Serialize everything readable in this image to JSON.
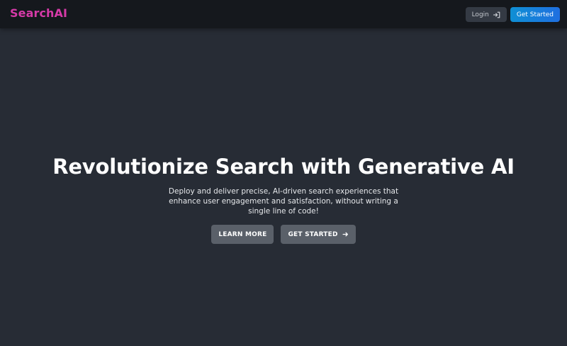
{
  "navbar": {
    "brand": "SearchAI",
    "login_label": "Login",
    "login_icon": "sign-in-icon",
    "get_started_label": "Get Started"
  },
  "hero": {
    "title": "Revolutionize Search with Generative AI",
    "subtitle": "Deploy and deliver precise, AI-driven search experiences that enhance user engagement and satisfaction, without writing a single line of code!",
    "learn_more_label": "LEARN MORE",
    "get_started_label": "GET STARTED",
    "get_started_icon": "arrow-right-icon"
  },
  "colors": {
    "background": "#272c35",
    "navbar": "#15181d",
    "brand": "#d63aa8",
    "primary_button": "#1f6fe0",
    "secondary_button": "#5a6069"
  }
}
